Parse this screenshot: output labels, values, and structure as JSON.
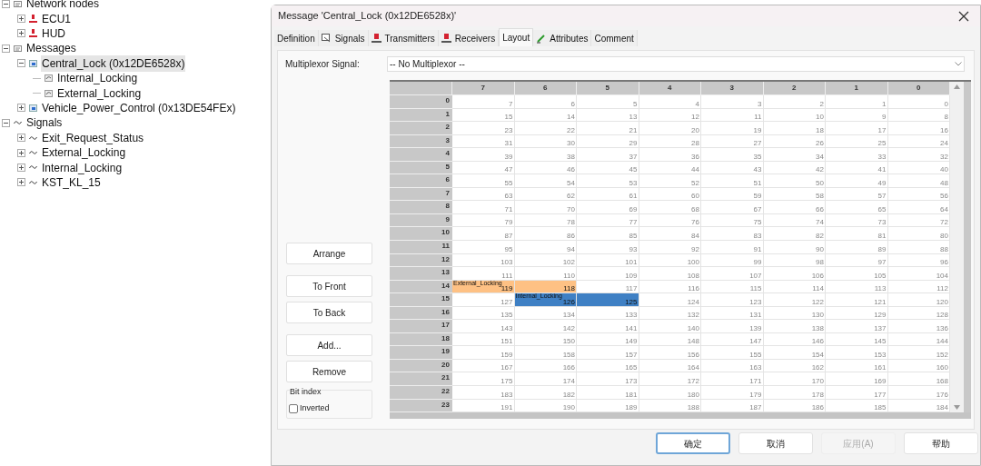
{
  "tree": [
    {
      "label": "Network nodes",
      "kind": "folder",
      "expanded": true,
      "selected": false,
      "children": [
        {
          "label": "ECU1",
          "kind": "node",
          "expanded": false,
          "selected": false
        },
        {
          "label": "HUD",
          "kind": "node",
          "expanded": false,
          "selected": false
        }
      ]
    },
    {
      "label": "Messages",
      "kind": "folder",
      "expanded": true,
      "selected": false,
      "children": [
        {
          "label": "Central_Lock (0x12DE6528x)",
          "kind": "message",
          "expanded": true,
          "selected": true,
          "children": [
            {
              "label": "Internal_Locking",
              "kind": "mapped",
              "selected": false
            },
            {
              "label": "External_Locking",
              "kind": "mapped",
              "selected": false
            }
          ]
        },
        {
          "label": "Vehicle_Power_Control (0x13DE54FEx)",
          "kind": "message",
          "expanded": false,
          "selected": false
        }
      ]
    },
    {
      "label": "Signals",
      "kind": "signal",
      "expanded": true,
      "selected": false,
      "children": [
        {
          "label": "Exit_Request_Status",
          "kind": "signal",
          "expanded": false,
          "selected": false
        },
        {
          "label": "External_Locking",
          "kind": "signal",
          "expanded": false,
          "selected": false
        },
        {
          "label": "Internal_Locking",
          "kind": "signal",
          "expanded": false,
          "selected": false
        },
        {
          "label": "KST_KL_15",
          "kind": "signal",
          "expanded": false,
          "selected": false
        }
      ]
    }
  ],
  "dialog": {
    "title": "Message 'Central_Lock (0x12DE6528x)'",
    "tabs": [
      {
        "label": "Definition",
        "kind": "plain",
        "selected": false
      },
      {
        "label": "Signals",
        "kind": "signals",
        "selected": false
      },
      {
        "label": "Transmitters",
        "kind": "node",
        "selected": false
      },
      {
        "label": "Receivers",
        "kind": "node",
        "selected": false
      },
      {
        "label": "Layout",
        "kind": "plain",
        "selected": true
      },
      {
        "label": "Attributes",
        "kind": "attributes",
        "selected": false
      },
      {
        "label": "Comment",
        "kind": "plain",
        "selected": false
      }
    ],
    "multiplexor": {
      "label": "Multiplexor Signal:",
      "value": "-- No Multiplexor --"
    },
    "side_buttons": [
      "Arrange",
      "To Front",
      "To Back",
      "Add...",
      "Remove"
    ],
    "bit_index": {
      "title": "Bit index",
      "inverted": {
        "label": "Inverted",
        "checked": false
      }
    },
    "layout_grid": {
      "columns": [
        "7",
        "6",
        "5",
        "4",
        "3",
        "2",
        "1",
        "0"
      ],
      "rows": [
        {
          "index": "0",
          "cells": [
            "7",
            "6",
            "5",
            "4",
            "3",
            "2",
            "1",
            "0"
          ]
        },
        {
          "index": "1",
          "cells": [
            "15",
            "14",
            "13",
            "12",
            "11",
            "10",
            "9",
            "8"
          ]
        },
        {
          "index": "2",
          "cells": [
            "23",
            "22",
            "21",
            "20",
            "19",
            "18",
            "17",
            "16"
          ]
        },
        {
          "index": "3",
          "cells": [
            "31",
            "30",
            "29",
            "28",
            "27",
            "26",
            "25",
            "24"
          ]
        },
        {
          "index": "4",
          "cells": [
            "39",
            "38",
            "37",
            "36",
            "35",
            "34",
            "33",
            "32"
          ]
        },
        {
          "index": "5",
          "cells": [
            "47",
            "46",
            "45",
            "44",
            "43",
            "42",
            "41",
            "40"
          ]
        },
        {
          "index": "6",
          "cells": [
            "55",
            "54",
            "53",
            "52",
            "51",
            "50",
            "49",
            "48"
          ]
        },
        {
          "index": "7",
          "cells": [
            "63",
            "62",
            "61",
            "60",
            "59",
            "58",
            "57",
            "56"
          ]
        },
        {
          "index": "8",
          "cells": [
            "71",
            "70",
            "69",
            "68",
            "67",
            "66",
            "65",
            "64"
          ]
        },
        {
          "index": "9",
          "cells": [
            "79",
            "78",
            "77",
            "76",
            "75",
            "74",
            "73",
            "72"
          ]
        },
        {
          "index": "10",
          "cells": [
            "87",
            "86",
            "85",
            "84",
            "83",
            "82",
            "81",
            "80"
          ]
        },
        {
          "index": "11",
          "cells": [
            "95",
            "94",
            "93",
            "92",
            "91",
            "90",
            "89",
            "88"
          ]
        },
        {
          "index": "12",
          "cells": [
            "103",
            "102",
            "101",
            "100",
            "99",
            "98",
            "97",
            "96"
          ]
        },
        {
          "index": "13",
          "cells": [
            "111",
            "110",
            "109",
            "108",
            "107",
            "106",
            "105",
            "104"
          ]
        },
        {
          "index": "14",
          "cells": [
            {
              "text": "119",
              "color": "#fec184",
              "signal": "External_Locking"
            },
            {
              "text": "118",
              "color": "#fec184"
            },
            "117",
            "116",
            "115",
            "114",
            "113",
            "112"
          ]
        },
        {
          "index": "15",
          "cells": [
            "127",
            {
              "text": "126",
              "color": "#3f80c4",
              "signal": "Internal_Locking"
            },
            {
              "text": "125",
              "color": "#3f80c4"
            },
            "124",
            "123",
            "122",
            "121",
            "120"
          ]
        },
        {
          "index": "16",
          "cells": [
            "135",
            "134",
            "133",
            "132",
            "131",
            "130",
            "129",
            "128"
          ]
        },
        {
          "index": "17",
          "cells": [
            "143",
            "142",
            "141",
            "140",
            "139",
            "138",
            "137",
            "136"
          ]
        },
        {
          "index": "18",
          "cells": [
            "151",
            "150",
            "149",
            "148",
            "147",
            "146",
            "145",
            "144"
          ]
        },
        {
          "index": "19",
          "cells": [
            "159",
            "158",
            "157",
            "156",
            "155",
            "154",
            "153",
            "152"
          ]
        },
        {
          "index": "20",
          "cells": [
            "167",
            "166",
            "165",
            "164",
            "163",
            "162",
            "161",
            "160"
          ]
        },
        {
          "index": "21",
          "cells": [
            "175",
            "174",
            "173",
            "172",
            "171",
            "170",
            "169",
            "168"
          ]
        },
        {
          "index": "22",
          "cells": [
            "183",
            "182",
            "181",
            "180",
            "179",
            "178",
            "177",
            "176"
          ]
        },
        {
          "index": "23",
          "cells": [
            "191",
            "190",
            "189",
            "188",
            "187",
            "186",
            "185",
            "184"
          ]
        }
      ]
    },
    "footer_buttons": [
      {
        "label": "确定",
        "focused": true,
        "disabled": false
      },
      {
        "label": "取消",
        "focused": false,
        "disabled": false
      },
      {
        "label": "应用(A)",
        "focused": false,
        "disabled": true
      },
      {
        "label": "帮助",
        "focused": false,
        "disabled": false
      }
    ]
  }
}
